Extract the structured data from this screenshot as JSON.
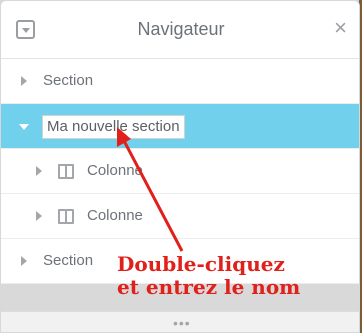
{
  "navigator": {
    "title": "Navigateur",
    "close_glyph": "×",
    "collapse_icon": "collapse-icon"
  },
  "tree": [
    {
      "label": "Section",
      "state": "collapsed"
    },
    {
      "label": "Ma nouvelle section",
      "state": "expanded-editing"
    },
    {
      "label": "Colonne",
      "state": "collapsed"
    },
    {
      "label": "Colonne",
      "state": "collapsed"
    },
    {
      "label": "Section",
      "state": "collapsed"
    }
  ],
  "footer": {
    "grip": "•••"
  },
  "annotation": {
    "line1": "Double-cliquez",
    "line2": "et entrez le nom",
    "color": "#e0201b"
  },
  "colors": {
    "selected_row": "#71d0ec",
    "text": "#6d7278"
  }
}
